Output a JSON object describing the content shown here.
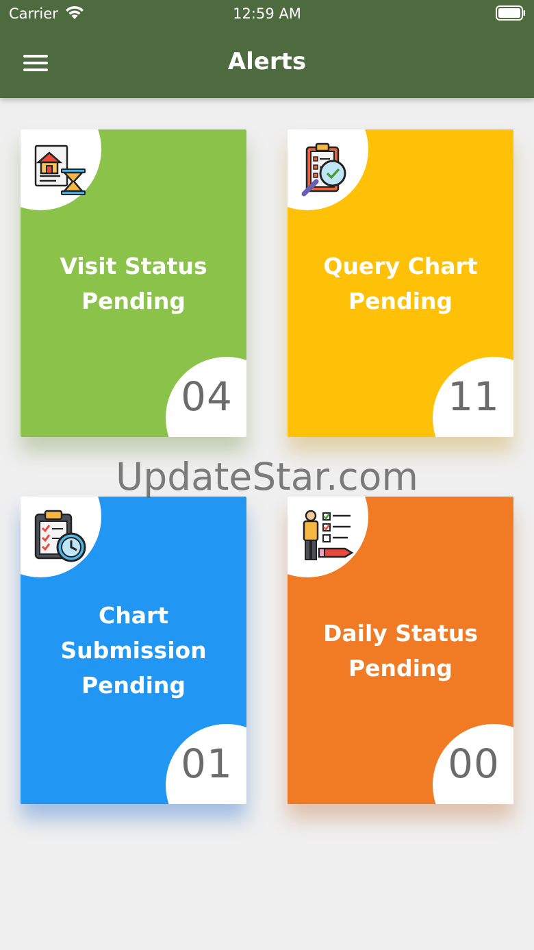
{
  "status_bar": {
    "carrier": "Carrier",
    "time": "12:59 AM"
  },
  "header": {
    "title": "Alerts",
    "menu_icon": "hamburger-menu-icon"
  },
  "cards": [
    {
      "label_lines": [
        "Visit Status",
        "Pending"
      ],
      "count": "04",
      "icon": "house-document-hourglass-icon",
      "color": "#8bc34a"
    },
    {
      "label_lines": [
        "Query Chart",
        "Pending"
      ],
      "count": "11",
      "icon": "clipboard-magnifier-icon",
      "color": "#ffc107"
    },
    {
      "label_lines": [
        "Chart",
        "Submission",
        "Pending"
      ],
      "count": "01",
      "icon": "checklist-clock-icon",
      "color": "#2196f3"
    },
    {
      "label_lines": [
        "Daily Status",
        "Pending"
      ],
      "count": "00",
      "icon": "person-checklist-icon",
      "color": "#f07b24"
    }
  ],
  "watermark": "UpdateStar.com"
}
